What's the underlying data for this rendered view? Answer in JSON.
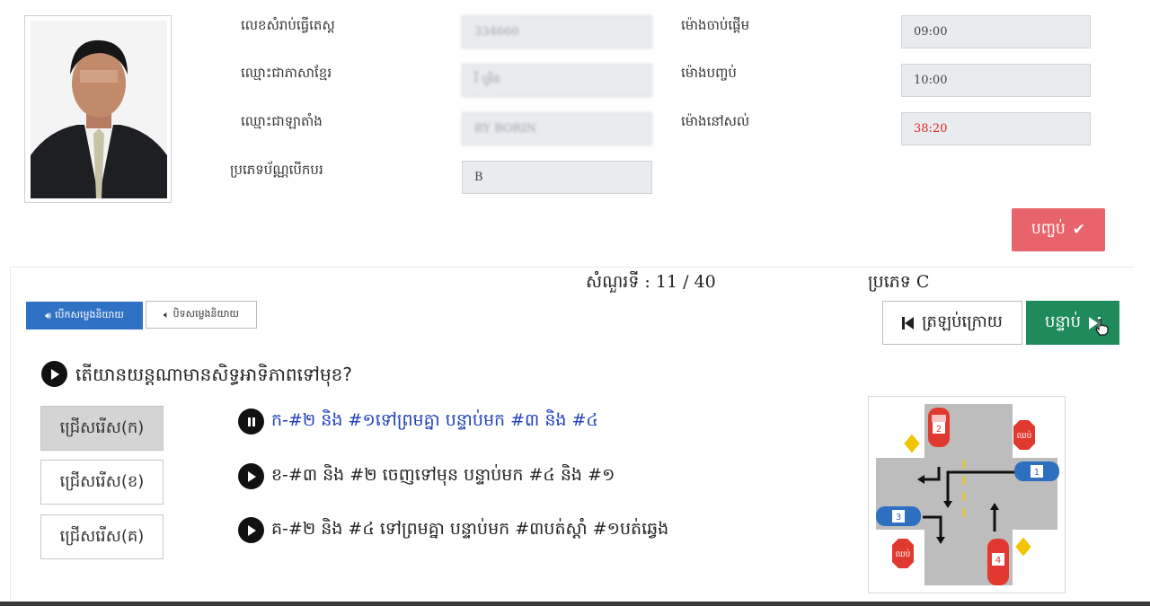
{
  "candidate": {
    "id_label": "លេខសំរាប់ធ្វើតេស្ត",
    "id_value": "334660",
    "khmer_name_label": "ឈ្មោះជាភាសាខ្មែរ",
    "khmer_name_value": "រី បូរិន",
    "latin_name_label": "ឈ្មោះជាឡាតាំង",
    "latin_name_value": "RY BORIN",
    "license_type_label": "ប្រភេទប័ណ្ណបើកបរ",
    "license_type_value": "B"
  },
  "timer": {
    "start_label": "ម៉ោងចាប់ផ្តើម",
    "start_value": "09:00",
    "end_label": "ម៉ោងបញ្ចប់",
    "end_value": "10:00",
    "remaining_label": "ម៉ោងនៅសល់",
    "remaining_value": "38:20"
  },
  "actions": {
    "finish_label": "បញ្ចប់",
    "sound_on_label": "បើកសម្លេងនិយាយ",
    "sound_off_label": "បិទសម្លេងនិយាយ",
    "prev_label": "ត្រឡប់ក្រោយ",
    "next_label": "បន្ទាប់"
  },
  "question": {
    "number_text": "សំណួរទី : 11 / 40",
    "type_text": "ប្រភេទ C",
    "text": "តើយានយន្តណាមានសិទ្ធអាទិភាពទៅមុខ?",
    "choices": [
      {
        "button": "ជ្រើសរើស(ក)",
        "answer": "ក-#២ និង #១ទៅព្រមគ្នា បន្ទាប់មក #៣ និង #៤",
        "selected": true
      },
      {
        "button": "ជ្រើសរើស(ខ)",
        "answer": "ខ-#៣ និង #២ ចេញទៅមុន បន្ទាប់មក #៤ និង #១",
        "selected": false
      },
      {
        "button": "ជ្រើសរើស(គ)",
        "answer": "គ-#២ និង #៤ ទៅព្រមគ្នា បន្ទាប់មក #៣បត់ស្តាំ #១បត់ឆ្វេង",
        "selected": false
      }
    ]
  },
  "diagram": {
    "car_labels": [
      "1",
      "2",
      "3",
      "4"
    ],
    "stop_sign_text": "ឈប់",
    "colors": {
      "red_car": "#e0392f",
      "blue_car": "#2e6fbf",
      "road": "#bdbdbd",
      "priority_sign": "#f2c500"
    }
  },
  "colors": {
    "finish_button": "#e8636b",
    "next_button": "#1f8a5a",
    "sound_on_button": "#2f72c4",
    "remaining_time": "#e02424",
    "active_answer": "#1f3fb8"
  }
}
